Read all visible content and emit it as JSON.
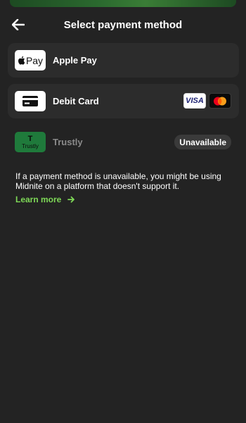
{
  "header": {
    "title": "Select payment method",
    "back_icon": "arrow-left-icon"
  },
  "methods": [
    {
      "label": "Apple Pay",
      "logo_text": "Pay",
      "icon": "apple-pay-icon"
    },
    {
      "label": "Debit Card",
      "icon": "credit-card-icon",
      "brands": [
        "VISA",
        "mastercard-icon"
      ]
    },
    {
      "label": "Trustly",
      "logo_text": "Trustly",
      "logo_glyph": "T",
      "icon": "trustly-icon",
      "status": "Unavailable"
    }
  ],
  "info": {
    "text": "If a payment method is unavailable, you might be using Midnite on a platform that doesn't support it.",
    "link_label": "Learn more",
    "link_icon": "arrow-right-icon"
  },
  "colors": {
    "background": "#232323",
    "card": "#2c2c2c",
    "accent": "#7ed957",
    "trustly": "#1f7a3b",
    "muted_text": "#8a8a8a"
  }
}
